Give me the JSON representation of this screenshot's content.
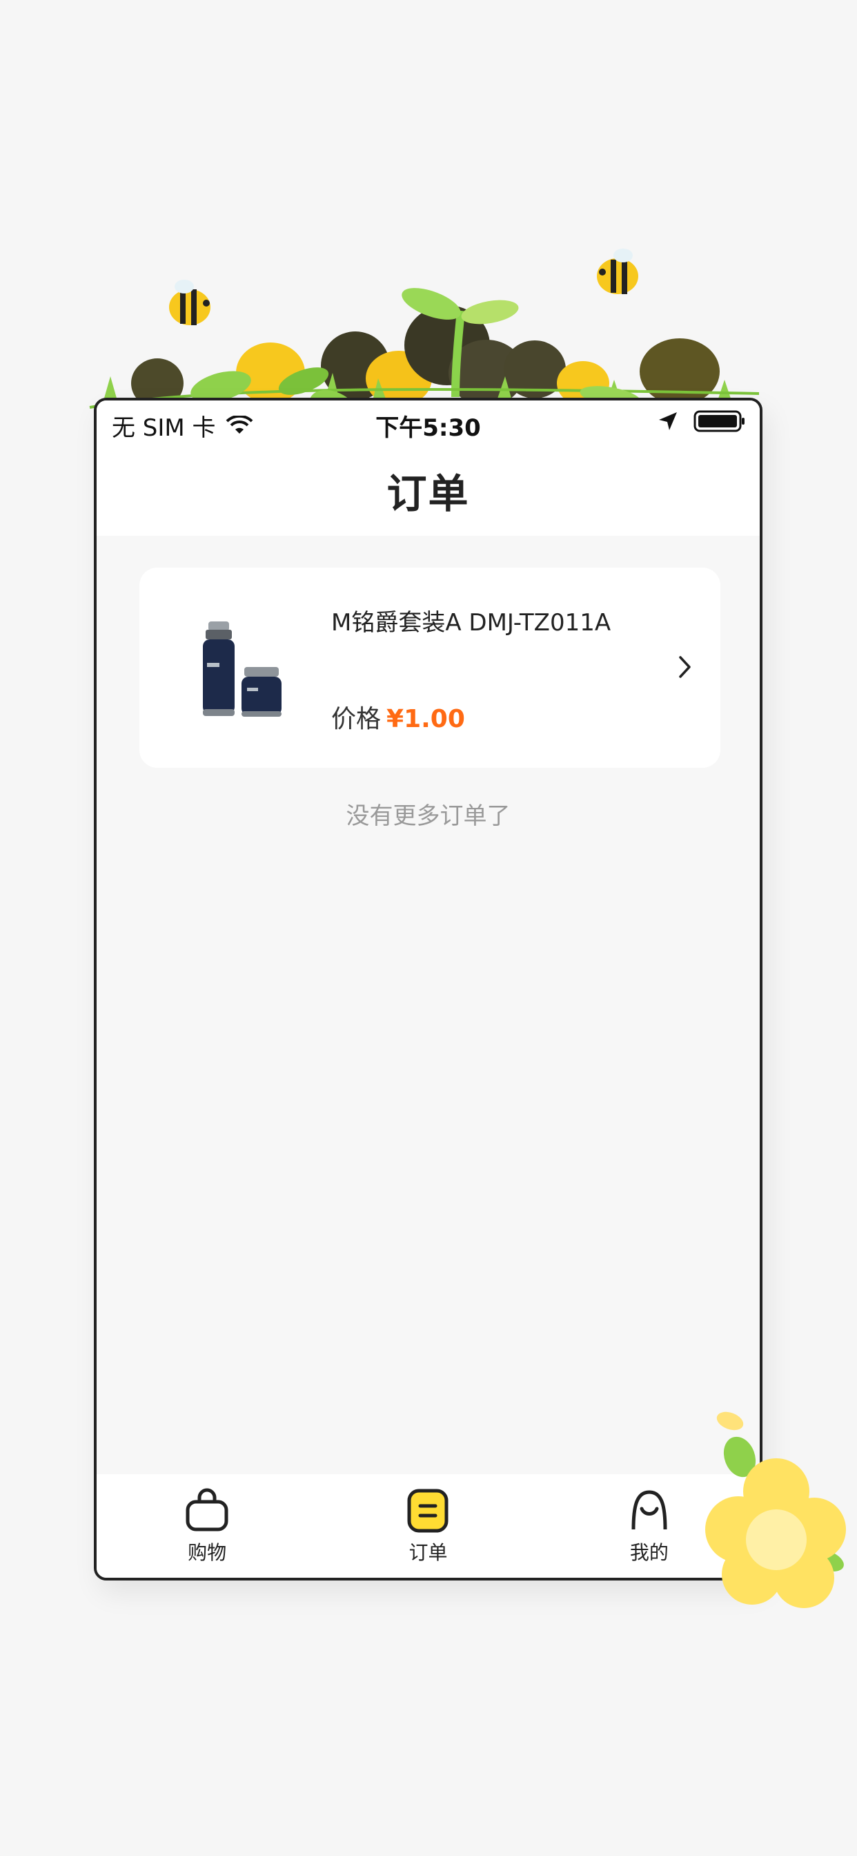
{
  "status_bar": {
    "carrier": "无 SIM 卡",
    "time": "下午5:30"
  },
  "nav": {
    "title": "订单"
  },
  "orders": [
    {
      "name": "M铭爵套装A DMJ-TZ011A",
      "price_label": "价格",
      "price_value": "¥1.00"
    }
  ],
  "list_footer": "没有更多订单了",
  "tabs": [
    {
      "label": "购物",
      "icon": "shopping-bag-icon",
      "active": false
    },
    {
      "label": "订单",
      "icon": "order-list-icon",
      "active": true
    },
    {
      "label": "我的",
      "icon": "profile-face-icon",
      "active": false
    }
  ],
  "colors": {
    "accent": "#ffdc33",
    "price": "#ff6a13",
    "muted": "#999999"
  }
}
